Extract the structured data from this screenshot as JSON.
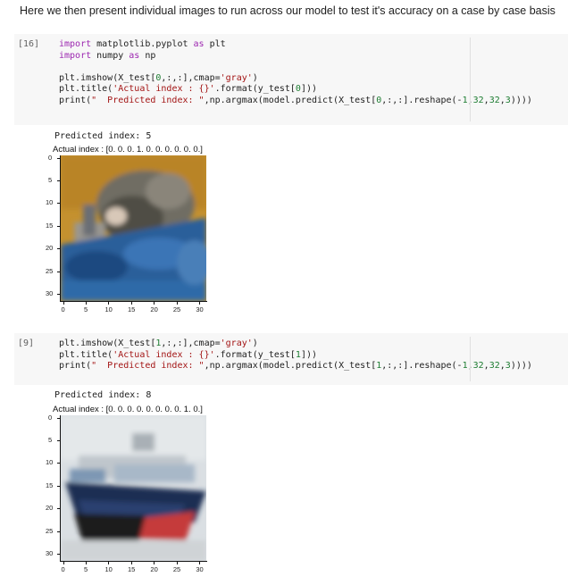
{
  "markdown": "Here we then present individual images to run across our model to test it's accuracy on a case by case basis",
  "cells": [
    {
      "prompt": "[16]",
      "code": [
        [
          {
            "t": "import",
            "c": "kw"
          },
          {
            "t": " matplotlib.pyplot ",
            "c": ""
          },
          {
            "t": "as",
            "c": "kw"
          },
          {
            "t": " plt",
            "c": ""
          }
        ],
        [
          {
            "t": "import",
            "c": "kw"
          },
          {
            "t": " numpy ",
            "c": ""
          },
          {
            "t": "as",
            "c": "kw"
          },
          {
            "t": " np",
            "c": ""
          }
        ],
        [],
        [
          {
            "t": "plt.imshow(X_test[",
            "c": ""
          },
          {
            "t": "0",
            "c": "num"
          },
          {
            "t": ",:,:],cmap=",
            "c": ""
          },
          {
            "t": "'gray'",
            "c": "str"
          },
          {
            "t": ")",
            "c": ""
          }
        ],
        [
          {
            "t": "plt.title(",
            "c": ""
          },
          {
            "t": "'Actual index : {}'",
            "c": "str"
          },
          {
            "t": ".format(y_test[",
            "c": ""
          },
          {
            "t": "0",
            "c": "num"
          },
          {
            "t": "]))",
            "c": ""
          }
        ],
        [
          {
            "t": "print(",
            "c": ""
          },
          {
            "t": "\"  Predicted index: \"",
            "c": "str"
          },
          {
            "t": ",np.argmax(model.predict(X_test[",
            "c": ""
          },
          {
            "t": "0",
            "c": "num"
          },
          {
            "t": ",:,:].reshape(-",
            "c": ""
          },
          {
            "t": "1",
            "c": "num"
          },
          {
            "t": ",",
            "c": ""
          },
          {
            "t": "32",
            "c": "num"
          },
          {
            "t": ",",
            "c": ""
          },
          {
            "t": "32",
            "c": "num"
          },
          {
            "t": ",",
            "c": ""
          },
          {
            "t": "3",
            "c": "num"
          },
          {
            "t": "))))",
            "c": ""
          }
        ]
      ],
      "output_text": "Predicted index:  5",
      "plot_title": "Actual index : [0. 0. 0. 1. 0. 0. 0. 0. 0. 0.]",
      "image_desc": "cat",
      "yticks": [
        "0",
        "5",
        "10",
        "15",
        "20",
        "25",
        "30"
      ],
      "xticks": [
        "0",
        "5",
        "10",
        "15",
        "20",
        "25",
        "30"
      ]
    },
    {
      "prompt": "[9]",
      "code": [
        [
          {
            "t": "plt.imshow(X_test[",
            "c": ""
          },
          {
            "t": "1",
            "c": "num"
          },
          {
            "t": ",:,:],cmap=",
            "c": ""
          },
          {
            "t": "'gray'",
            "c": "str"
          },
          {
            "t": ")",
            "c": ""
          }
        ],
        [
          {
            "t": "plt.title(",
            "c": ""
          },
          {
            "t": "'Actual index : {}'",
            "c": "str"
          },
          {
            "t": ".format(y_test[",
            "c": ""
          },
          {
            "t": "1",
            "c": "num"
          },
          {
            "t": "]))",
            "c": ""
          }
        ],
        [
          {
            "t": "print(",
            "c": ""
          },
          {
            "t": "\"  Predicted index: \"",
            "c": "str"
          },
          {
            "t": ",np.argmax(model.predict(X_test[",
            "c": ""
          },
          {
            "t": "1",
            "c": "num"
          },
          {
            "t": ",:,:].reshape(-",
            "c": ""
          },
          {
            "t": "1",
            "c": "num"
          },
          {
            "t": ",",
            "c": ""
          },
          {
            "t": "32",
            "c": "num"
          },
          {
            "t": ",",
            "c": ""
          },
          {
            "t": "32",
            "c": "num"
          },
          {
            "t": ",",
            "c": ""
          },
          {
            "t": "3",
            "c": "num"
          },
          {
            "t": "))))",
            "c": ""
          }
        ]
      ],
      "output_text": "Predicted index:  8",
      "plot_title": "Actual index : [0. 0. 0. 0. 0. 0. 0. 0. 1. 0.]",
      "image_desc": "ship",
      "yticks": [
        "0",
        "5",
        "10",
        "15",
        "20",
        "25",
        "30"
      ],
      "xticks": [
        "0",
        "5",
        "10",
        "15",
        "20",
        "25",
        "30"
      ]
    }
  ]
}
